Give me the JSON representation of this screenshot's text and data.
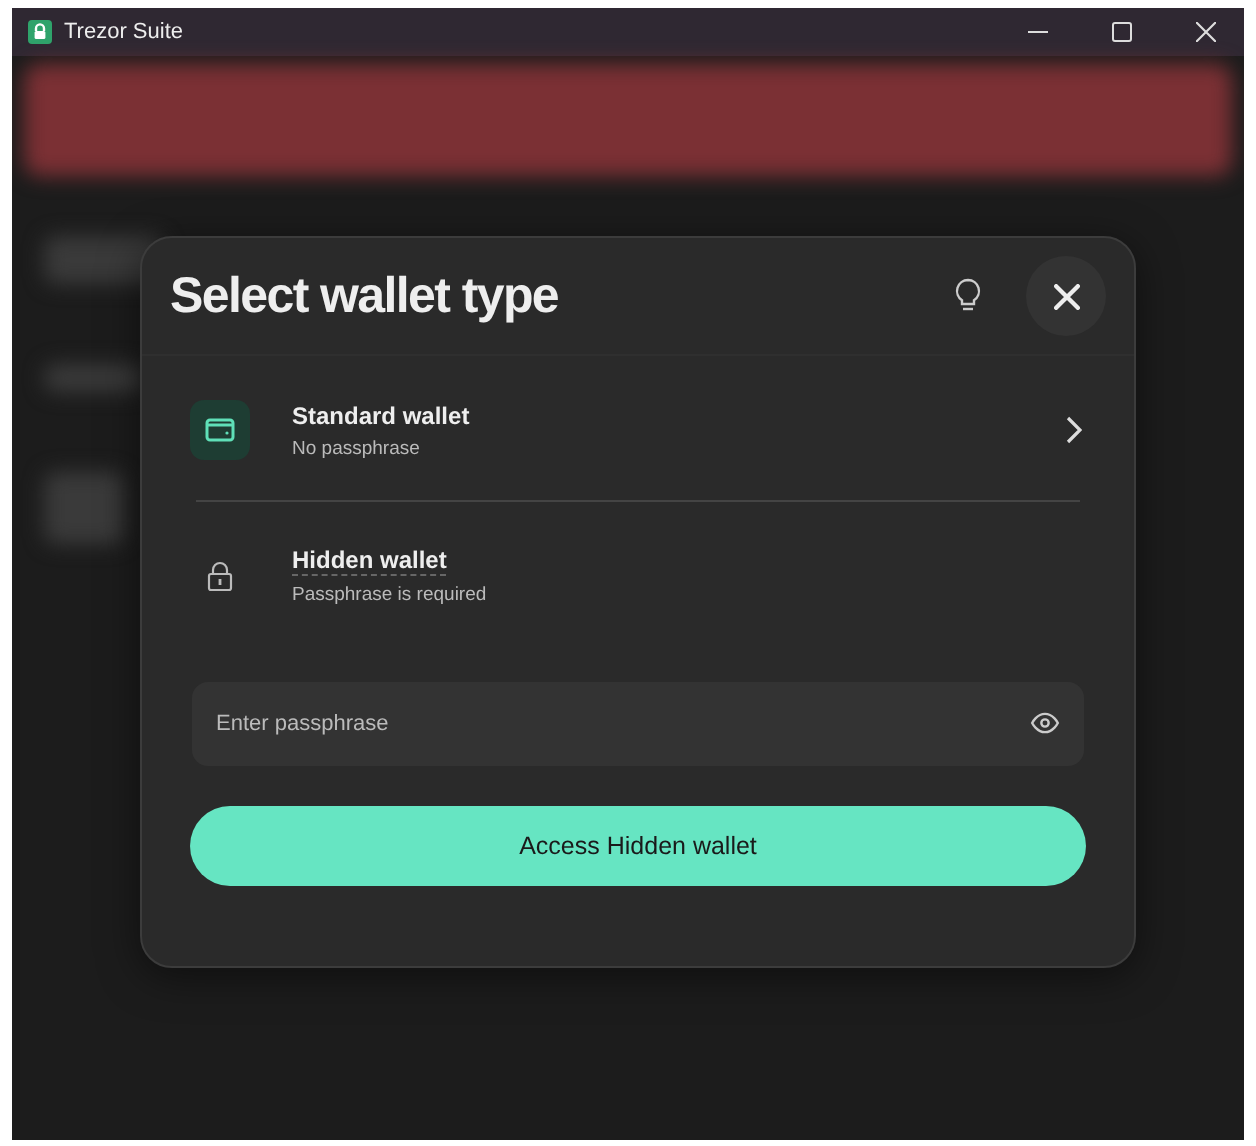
{
  "window": {
    "title": "Trezor Suite"
  },
  "modal": {
    "title": "Select wallet type",
    "options": [
      {
        "kind": "standard",
        "title": "Standard wallet",
        "subtitle": "No passphrase"
      },
      {
        "kind": "hidden",
        "title": "Hidden wallet",
        "subtitle": "Passphrase is required"
      }
    ],
    "passphrase": {
      "placeholder": "Enter passphrase"
    },
    "submit": "Access Hidden wallet"
  }
}
